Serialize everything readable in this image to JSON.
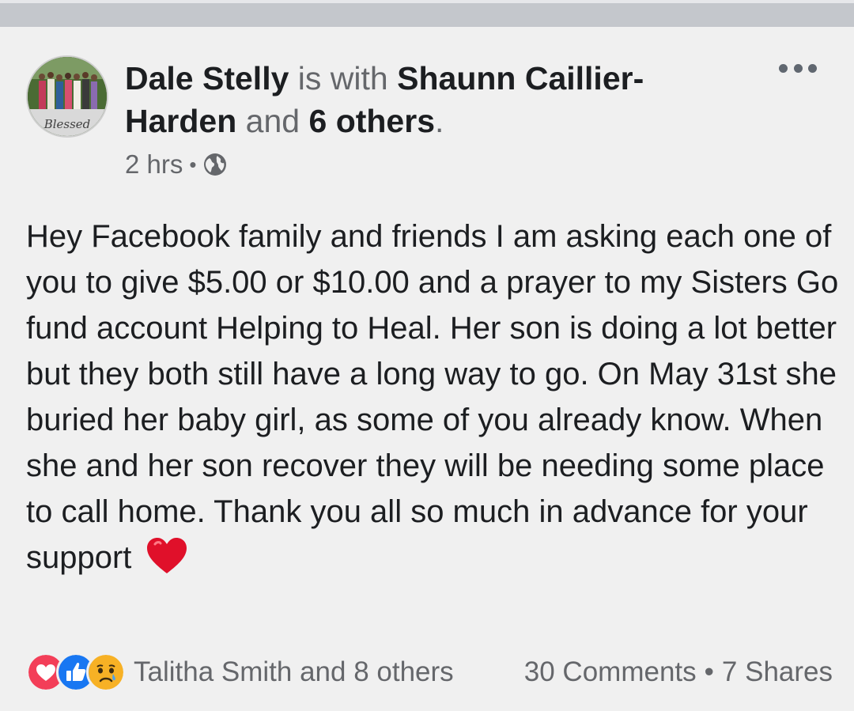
{
  "post": {
    "author": "Dale Stelly",
    "with_text": "is with",
    "tagged": "Shaunn Caillier-Harden",
    "and_text": "and",
    "others_tagged": "6 others",
    "period": ".",
    "time": "2 hrs",
    "dot": "•",
    "privacy_icon": "globe-icon",
    "avatar_text": "Blessed",
    "body": "Hey Facebook family and friends I am asking each one of you to give $5.00 or $10.00 and a prayer to my Sisters Go fund account Helping to Heal. Her son is doing a lot better but they both still have a long way to go. On May 31st she buried her baby girl, as some of you already know. When she and her son recover they will be needing some place to call home. Thank you all so much in advance for your support",
    "body_emoji": "red-heart-emoji"
  },
  "footer": {
    "reactions": [
      "love-reaction-icon",
      "like-reaction-icon",
      "sad-reaction-icon"
    ],
    "reactors": "Talitha Smith and 8 others",
    "comments": "30 Comments",
    "dot": "•",
    "shares": "7 Shares"
  },
  "colors": {
    "text": "#1c1e21",
    "muted": "#65676b",
    "like_blue": "#1877f2",
    "love_red": "#f33e58",
    "sad_yellow": "#f7b125",
    "background": "#f0f0f0"
  }
}
